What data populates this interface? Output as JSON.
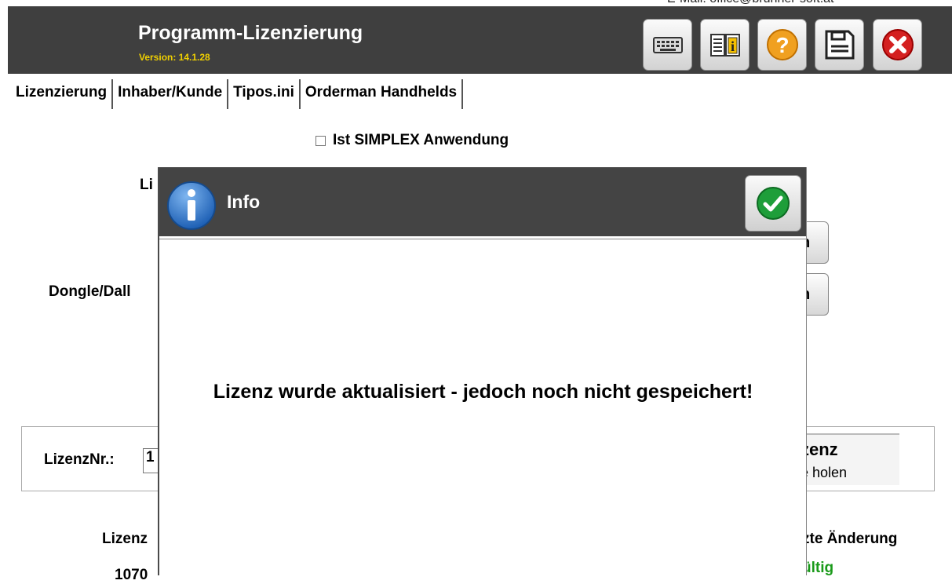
{
  "header": {
    "title": "Programm-Lizenzierung",
    "version": "Version: 14.1.28",
    "email_partial": "E-Mail: office@brunner-soft.at",
    "icons": [
      "keyboard-icon",
      "manual-info-icon",
      "help-icon",
      "save-icon",
      "close-icon"
    ]
  },
  "tabs": [
    "Lizenzierung",
    "Inhaber/Kunde",
    "Tipos.ini",
    "Orderman Handhelds"
  ],
  "form": {
    "simplex_label": "Ist SIMPLEX Anwendung",
    "simplex_checked": false,
    "label_li": "Li",
    "label_dongle": "Dongle/Dall",
    "btn1_tail": "n",
    "btn2_tail": "n",
    "lizenznr_label": "LizenzNr.:",
    "lizenznr_value": "1",
    "get_license_title": "zenz",
    "get_license_sub": "e holen",
    "col_lizenz": "Lizenz",
    "col_change": "zte Änderung",
    "row_value_partial": "1070",
    "status_valid": "ültig"
  },
  "modal": {
    "title": "Info",
    "message": "Lizenz wurde aktualisiert - jedoch noch nicht gespeichert!"
  },
  "colors": {
    "header_bg": "#3f3f3f",
    "version": "#f0d000",
    "valid": "#1a9a1a",
    "close_red": "#d42020",
    "help_orange": "#f0a020"
  }
}
